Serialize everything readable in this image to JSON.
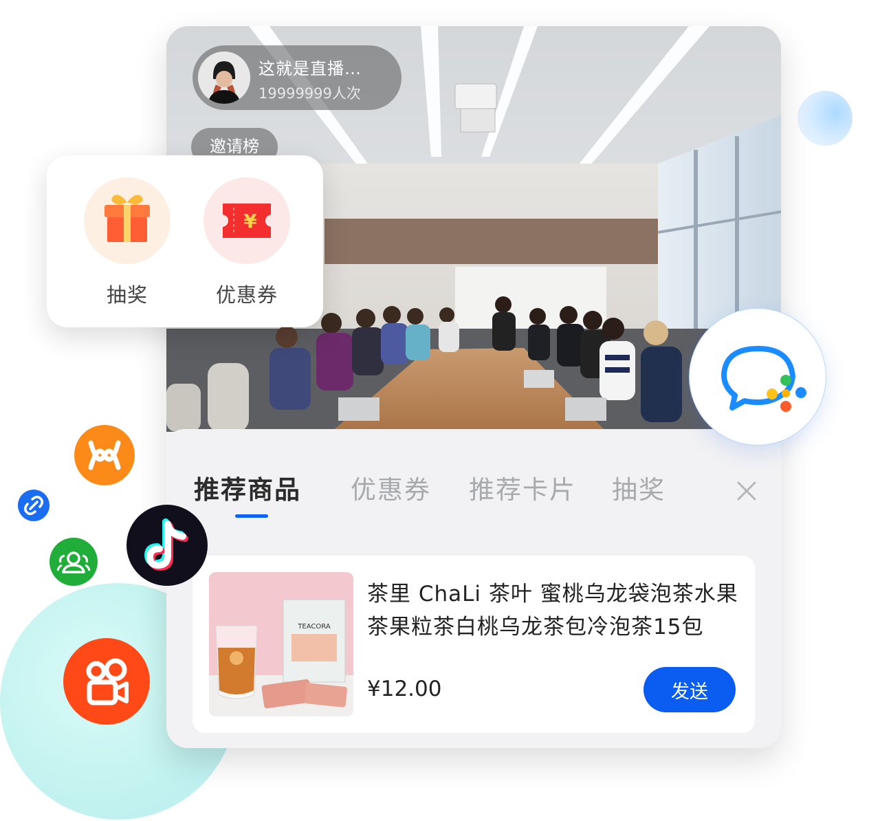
{
  "live": {
    "title": "这就是直播…",
    "viewers": "19999999人次",
    "invite_label": "邀请榜"
  },
  "promo_card": {
    "lottery_label": "抽奖",
    "coupon_label": "优惠券"
  },
  "tabs": [
    {
      "label": "推荐商品",
      "active": true
    },
    {
      "label": "优惠券",
      "active": false
    },
    {
      "label": "推荐卡片",
      "active": false
    },
    {
      "label": "抽奖",
      "active": false
    }
  ],
  "close_icon": "close-icon",
  "product": {
    "title": "茶里 ChaLi 茶叶 蜜桃乌龙袋泡茶水果茶果粒茶白桃乌龙茶包冷泡茶15包",
    "price": "¥12.00",
    "send_label": "发送",
    "image_brand": "TEACORA"
  },
  "colors": {
    "accent": "#0b5cf0",
    "tab_active": "#2b2b2b",
    "tab_inactive": "#a7a9ad"
  },
  "app_icons": [
    "miniapp-orange-icon",
    "link-icon",
    "group-icon",
    "tiktok-icon",
    "kuaishou-icon",
    "wecom-chat-icon"
  ]
}
